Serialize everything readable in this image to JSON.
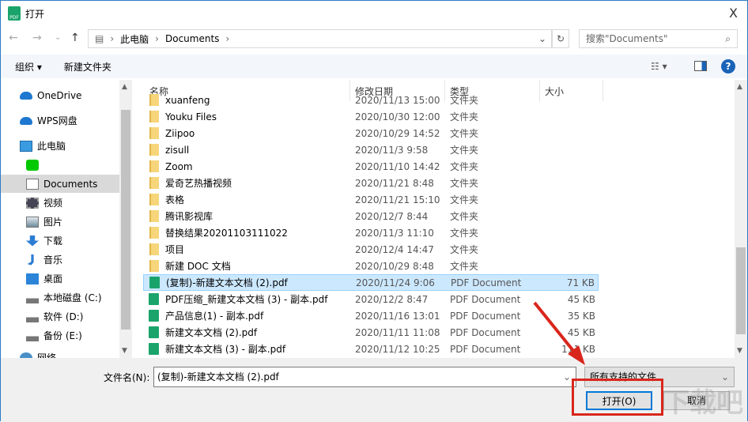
{
  "title": "打开",
  "close": "X",
  "nav": {
    "back": "←",
    "forward": "→",
    "recent": "⌄",
    "up": "↑"
  },
  "address": {
    "crumbs": [
      "此电脑",
      "Documents"
    ],
    "sep": "›"
  },
  "search": {
    "placeholder": "搜索\"Documents\""
  },
  "toolbar": {
    "organize": "组织 ▾",
    "new_folder": "新建文件夹",
    "view": "☷ ▾",
    "help": "?"
  },
  "sidebar": {
    "items": [
      {
        "label": "OneDrive",
        "icon": "cloud-icon"
      },
      {
        "label": "WPS网盘",
        "icon": "cloud-icon"
      },
      {
        "label": "此电脑",
        "icon": "computer-icon"
      },
      {
        "label": "",
        "icon": "iqiyi-icon"
      },
      {
        "label": "Documents",
        "icon": "document-icon",
        "selected": true
      },
      {
        "label": "视频",
        "icon": "video-icon"
      },
      {
        "label": "图片",
        "icon": "picture-icon"
      },
      {
        "label": "下载",
        "icon": "download-icon"
      },
      {
        "label": "音乐",
        "icon": "music-icon"
      },
      {
        "label": "桌面",
        "icon": "desktop-icon"
      },
      {
        "label": "本地磁盘 (C:)",
        "icon": "drive-icon"
      },
      {
        "label": "软件 (D:)",
        "icon": "drive-icon"
      },
      {
        "label": "备份 (E:)",
        "icon": "drive-icon"
      },
      {
        "label": "网络",
        "icon": "network-icon"
      }
    ]
  },
  "columns": {
    "name": "名称",
    "date": "修改日期",
    "type": "类型",
    "size": "大小"
  },
  "files": [
    {
      "name": "xuanfeng",
      "date": "2020/11/13 15:00",
      "type": "文件夹",
      "size": "",
      "kind": "folder"
    },
    {
      "name": "Youku Files",
      "date": "2020/10/30 12:00",
      "type": "文件夹",
      "size": "",
      "kind": "folder"
    },
    {
      "name": "Ziipoo",
      "date": "2020/10/29 14:52",
      "type": "文件夹",
      "size": "",
      "kind": "folder"
    },
    {
      "name": "zisull",
      "date": "2020/11/3 9:58",
      "type": "文件夹",
      "size": "",
      "kind": "folder"
    },
    {
      "name": "Zoom",
      "date": "2020/11/10 14:42",
      "type": "文件夹",
      "size": "",
      "kind": "folder"
    },
    {
      "name": "爱奇艺热播视频",
      "date": "2020/11/21 8:48",
      "type": "文件夹",
      "size": "",
      "kind": "folder"
    },
    {
      "name": "表格",
      "date": "2020/11/21 15:10",
      "type": "文件夹",
      "size": "",
      "kind": "folder"
    },
    {
      "name": "腾讯影视库",
      "date": "2020/12/7 8:44",
      "type": "文件夹",
      "size": "",
      "kind": "folder"
    },
    {
      "name": "替换结果20201103111022",
      "date": "2020/11/3 11:10",
      "type": "文件夹",
      "size": "",
      "kind": "folder"
    },
    {
      "name": "项目",
      "date": "2020/12/4 14:47",
      "type": "文件夹",
      "size": "",
      "kind": "folder"
    },
    {
      "name": "新建 DOC 文档",
      "date": "2020/10/29 8:48",
      "type": "文件夹",
      "size": "",
      "kind": "folder"
    },
    {
      "name": "(复制)-新建文本文档 (2).pdf",
      "date": "2020/11/24 9:06",
      "type": "PDF Document",
      "size": "71 KB",
      "kind": "pdf",
      "selected": true
    },
    {
      "name": "PDF压缩_新建文本文档 (3) - 副本.pdf",
      "date": "2020/12/2 8:47",
      "type": "PDF Document",
      "size": "45 KB",
      "kind": "pdf"
    },
    {
      "name": "产品信息(1) - 副本.pdf",
      "date": "2020/11/16 13:01",
      "type": "PDF Document",
      "size": "35 KB",
      "kind": "pdf"
    },
    {
      "name": "新建文本文档 (2).pdf",
      "date": "2020/11/11 11:08",
      "type": "PDF Document",
      "size": "45 KB",
      "kind": "pdf"
    },
    {
      "name": "新建文本文档 (3) - 副本.pdf",
      "date": "2020/11/12 10:25",
      "type": "PDF Document",
      "size": "111 KB",
      "kind": "pdf"
    }
  ],
  "bottom": {
    "filename_label": "文件名(N):",
    "filename_value": "(复制)-新建文本文档 (2).pdf",
    "filter": "所有支持的文件",
    "open": "打开(O)",
    "cancel": "取消"
  },
  "watermark": "下载吧",
  "colors": {
    "accent": "#0078d7",
    "annotation": "#d9261c",
    "selection": "#cce8ff"
  }
}
